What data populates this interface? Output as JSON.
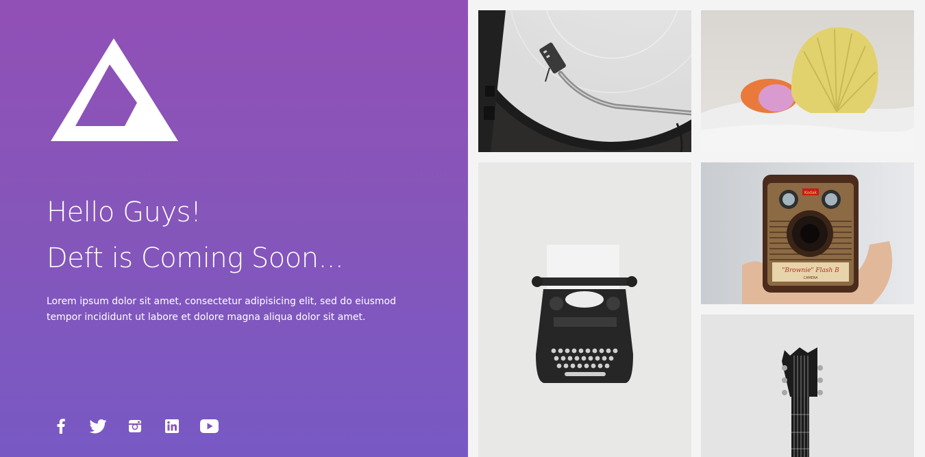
{
  "hero": {
    "logo_icon": "triangle-logo-icon",
    "headline_1": "Hello Guys!",
    "headline_2": "Deft is Coming Soon...",
    "description": "Lorem ipsum dolor sit amet, consectetur adipisicing elit, sed do eiusmod tempor incididunt ut labore et dolore magna aliqua dolor sit amet.",
    "gradient_top": "#9150b6",
    "gradient_bottom": "#7859c4"
  },
  "social": [
    {
      "network": "facebook",
      "icon": "facebook-icon"
    },
    {
      "network": "twitter",
      "icon": "twitter-icon"
    },
    {
      "network": "instagram",
      "icon": "instagram-icon"
    },
    {
      "network": "linkedin",
      "icon": "linkedin-icon"
    },
    {
      "network": "youtube",
      "icon": "youtube-icon"
    }
  ],
  "gallery": {
    "background": "#f4f4f4",
    "photo_names": [
      "turntable",
      "seashell",
      "typewriter",
      "box camera",
      "guitar"
    ],
    "camera_brand_text": "Kodak",
    "camera_model_text": "\"Brownie\" Flash B",
    "camera_sub_text": "CAMERA"
  }
}
